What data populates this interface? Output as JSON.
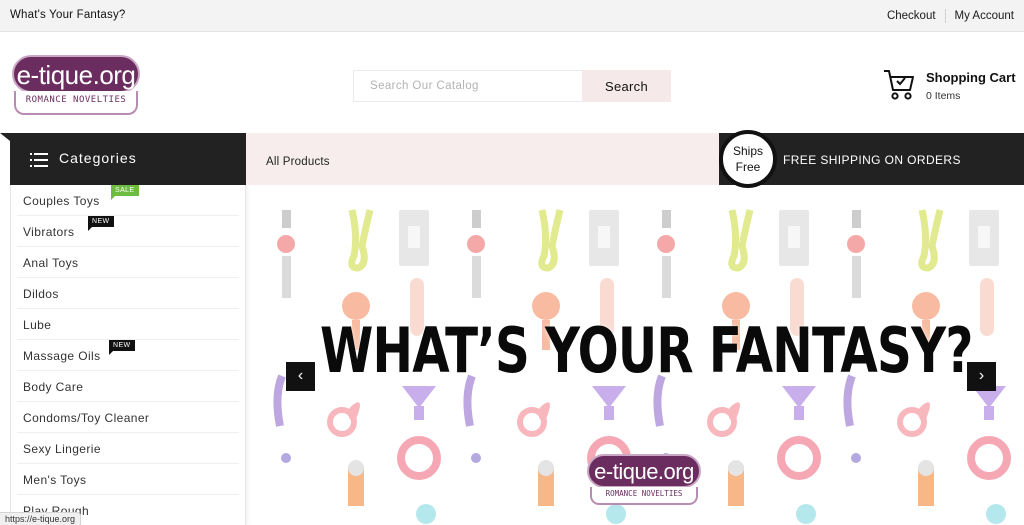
{
  "topbar": {
    "tagline": "What's Your Fantasy?",
    "links": [
      "Checkout",
      "My Account"
    ]
  },
  "logo": {
    "name": "e-tique.org",
    "subtitle": "ROMANCE NOVELTIES"
  },
  "search": {
    "placeholder": "Search Our Catalog",
    "button_label": "Search"
  },
  "cart": {
    "title": "Shopping Cart",
    "count_text": "0 Items",
    "icon": "cart-icon"
  },
  "categories": {
    "heading": "Categories",
    "icon": "menu-icon",
    "items": [
      {
        "label": "Couples Toys",
        "badge": "SALE"
      },
      {
        "label": "Vibrators",
        "badge": "NEW"
      },
      {
        "label": "Anal Toys",
        "badge": ""
      },
      {
        "label": "Dildos",
        "badge": ""
      },
      {
        "label": "Lube",
        "badge": ""
      },
      {
        "label": "Massage Oils",
        "badge": "NEW"
      },
      {
        "label": "Body Care",
        "badge": ""
      },
      {
        "label": "Condoms/Toy Cleaner",
        "badge": ""
      },
      {
        "label": "Sexy Lingerie",
        "badge": ""
      },
      {
        "label": "Men's Toys",
        "badge": ""
      },
      {
        "label": "Play Rough",
        "badge": ""
      }
    ]
  },
  "nav": {
    "all_products": "All Products",
    "ships_free_line1": "Ships",
    "ships_free_line2": "Free",
    "shipping_text": "FREE SHIPPING ON ORDERS"
  },
  "hero": {
    "headline": "WHAT’S YOUR FANTASY?",
    "prev_icon": "chevron-left-icon",
    "next_icon": "chevron-right-icon",
    "prev_glyph": "‹",
    "next_glyph": "›"
  },
  "status_url": "https://e-tique.org",
  "colors": {
    "brand": "#6b2d5f",
    "dark": "#222222",
    "nav_bg": "#f7eded",
    "sale": "#6dbb3f"
  }
}
